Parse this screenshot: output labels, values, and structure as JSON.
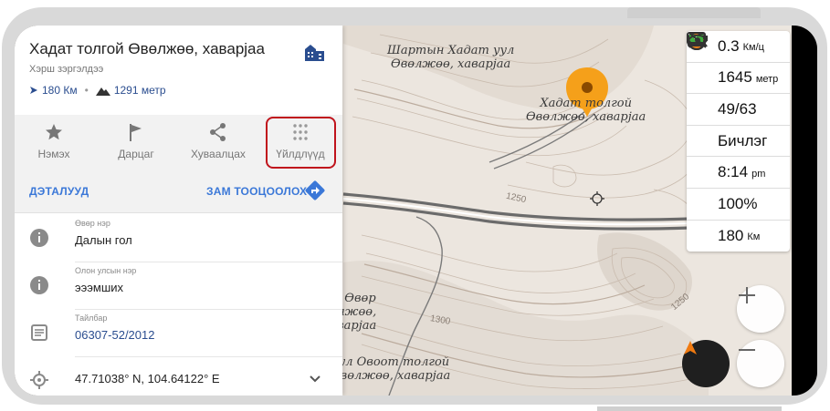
{
  "poi": {
    "title": "Хадат толгой Өвөлжөө, хаварjaa",
    "subtitle": "Хэрш зэргэлдээ",
    "distance": "180 Км",
    "elevation": "1291 метр"
  },
  "actions": [
    {
      "label": "Нэмэх",
      "icon": "star-icon"
    },
    {
      "label": "Дарцаг",
      "icon": "flag-icon"
    },
    {
      "label": "Хуваалцах",
      "icon": "share-icon"
    },
    {
      "label": "Үйлдлүүд",
      "icon": "dots-grid-icon"
    }
  ],
  "links": {
    "details": "ДЭТАЛУУД",
    "route": "ЗАМ ТООЦООЛОХ"
  },
  "info": [
    {
      "label": "Өвөр нэр",
      "value": "Далын гол",
      "icon": "info-icon"
    },
    {
      "label": "Олон улсын нэр",
      "value": "эээмших",
      "icon": "info-icon"
    },
    {
      "label": "Тайлбар",
      "value": "06307-52/2012",
      "icon": "description-icon"
    },
    {
      "label": "",
      "value": "47.71038° N, 104.64122° E",
      "icon": "location-target-icon"
    }
  ],
  "map": {
    "labels": [
      {
        "text": "Шартын Хадат уул\nӨвөлжөө, хаварjaa"
      },
      {
        "text": "Хадат толгой\nӨвөлжөө, хаварjaa"
      },
      {
        "text": "ын Өвөр\nвөлжөө,\nхаварjaa"
      },
      {
        "text": "уул Овоот толгой\nӨвөлжөө, хаварjaa"
      }
    ],
    "contours": [
      "1250",
      "1300",
      "1250"
    ]
  },
  "widgets": [
    {
      "icon": "speed-icon",
      "value": "0.3",
      "unit": "Км/ц"
    },
    {
      "icon": "mountain-icon",
      "value": "1645",
      "unit": "метр"
    },
    {
      "icon": "satellite-icon",
      "value": "49/63",
      "unit": ""
    },
    {
      "icon": "record-icon",
      "value": "Бичлэг",
      "unit": ""
    },
    {
      "icon": "clock-icon",
      "value": "8:14",
      "unit": "pm"
    },
    {
      "icon": "battery-icon",
      "value": "100%",
      "unit": ""
    },
    {
      "icon": "eye-off-icon",
      "value": "180",
      "unit": "Км"
    }
  ],
  "colors": {
    "accent": "#3b78d8",
    "highlight": "#c0141c",
    "marker": "#f39c12",
    "map_bg": "#ece6df"
  }
}
